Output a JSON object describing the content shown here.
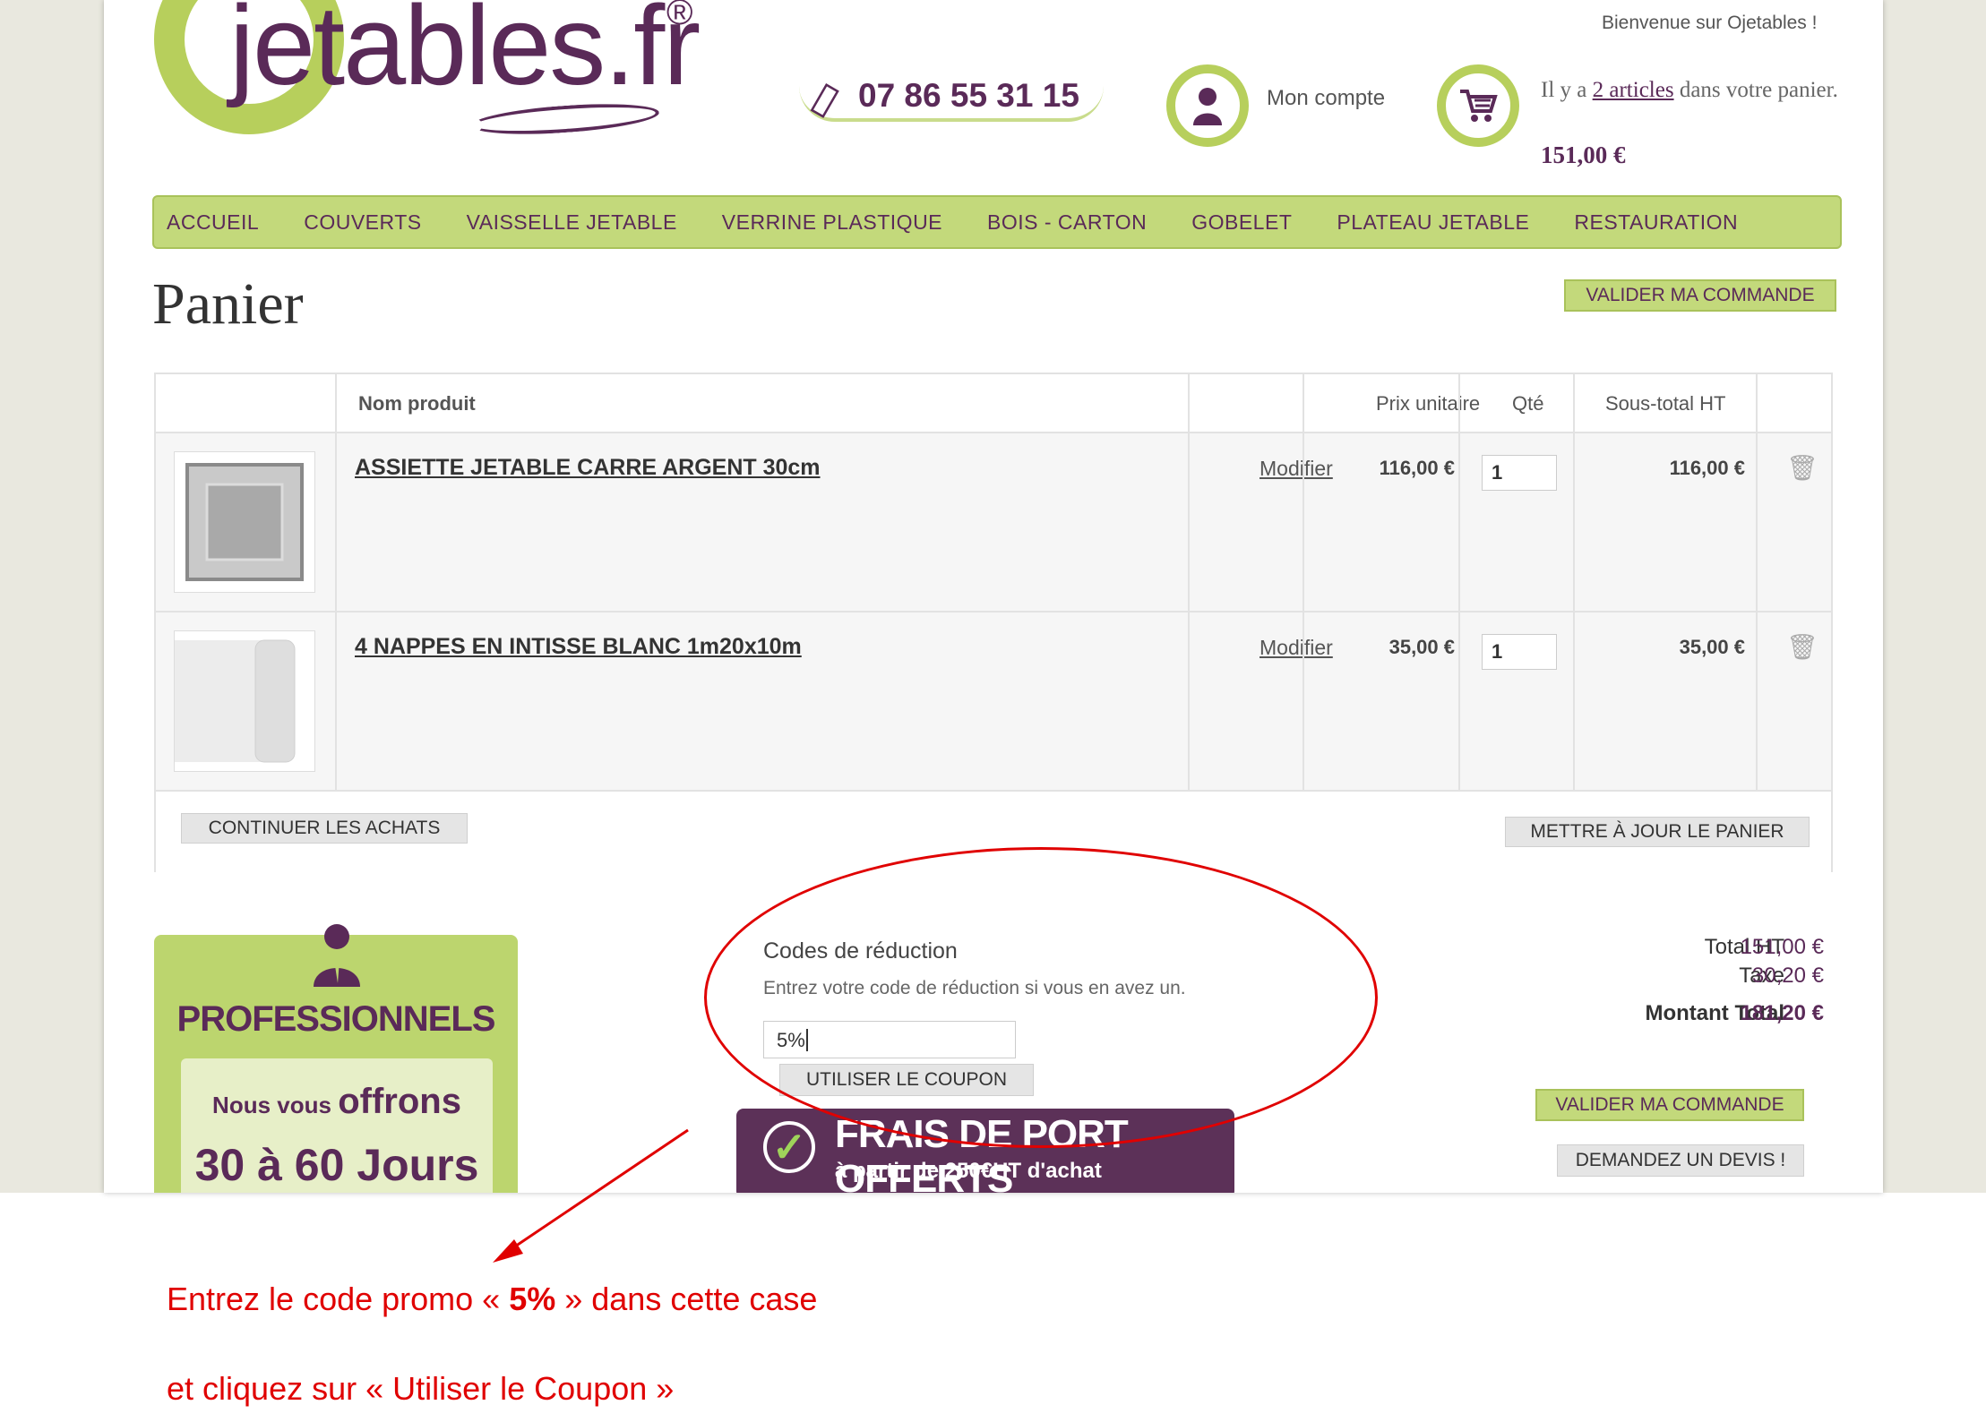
{
  "header": {
    "logo_text": "jetables.fr",
    "logo_reg": "®",
    "phone": "07 86 55 31 15",
    "account_label": "Mon compte",
    "welcome": "Bienvenue sur Ojetables !",
    "cart_prefix": "Il y a",
    "cart_link": "2 articles",
    "cart_suffix": "dans votre panier.",
    "cart_total": "151,00 €"
  },
  "nav": [
    "ACCUEIL",
    "COUVERTS",
    "VAISSELLE JETABLE",
    "VERRINE PLASTIQUE",
    "BOIS - CARTON",
    "GOBELET",
    "PLATEAU JETABLE",
    "RESTAURATION"
  ],
  "page_title": "Panier",
  "validate_top": "VALIDER MA COMMANDE",
  "table": {
    "headers": {
      "name": "Nom produit",
      "unit_price": "Prix unitaire",
      "qty": "Qté",
      "subtotal": "Sous-total HT"
    },
    "rows": [
      {
        "name": "ASSIETTE JETABLE CARRE ARGENT 30cm",
        "modify": "Modifier",
        "price": "116,00 €",
        "qty": "1",
        "subtotal": "116,00 €"
      },
      {
        "name": "4 NAPPES EN INTISSE BLANC 1m20x10m",
        "modify": "Modifier",
        "price": "35,00 €",
        "qty": "1",
        "subtotal": "35,00 €"
      }
    ],
    "continue": "CONTINUER LES ACHATS",
    "update": "METTRE À JOUR LE PANIER"
  },
  "pro": {
    "title": "PROFESSIONNELS",
    "line1_a": "Nous vous ",
    "line1_b": "offrons",
    "line2": "30 à 60 Jours"
  },
  "coupon": {
    "title": "Codes de réduction",
    "hint": "Entrez votre code de réduction si vous en avez un.",
    "value": "5%",
    "button": "UTILISER LE COUPON"
  },
  "banner": {
    "big": "FRAIS DE PORT OFFERTS",
    "small": "à partir de 250€HT d'achat"
  },
  "totals": {
    "ht_label": "Total HT",
    "ht_value": "151,00 €",
    "tax_label": "Taxe",
    "tax_value": "30,20 €",
    "total_label": "Montant Total",
    "total_value": "181,20 €"
  },
  "validate_bottom": "VALIDER MA COMMANDE",
  "quote": "DEMANDEZ UN DEVIS !",
  "annotation": {
    "line1_a": "Entrez le code promo «  ",
    "line1_b": "5%",
    "line1_c": " » dans cette case",
    "line2": "et cliquez sur « Utiliser le Coupon »"
  },
  "colors": {
    "brand_purple": "#5a2a58",
    "brand_green": "#b7cf5c",
    "annotation_red": "#e00000"
  }
}
